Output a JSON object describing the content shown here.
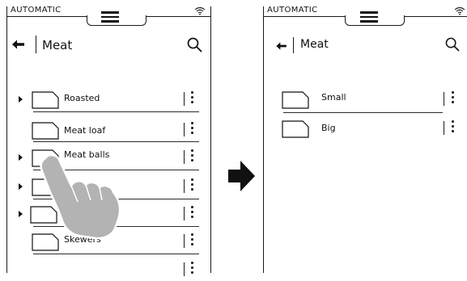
{
  "left_screen": {
    "status": {
      "mode": "AUTOMATIC",
      "menu_icon": "hamburger-menu-icon",
      "signal_icon": "wifi-icon"
    },
    "header": {
      "back_icon": "back-arrow-icon",
      "title": "Meat",
      "search_icon": "search-icon"
    },
    "items": [
      {
        "label": "Roasted",
        "expandable": true
      },
      {
        "label": "Meat loaf",
        "expandable": false
      },
      {
        "label": "Meat balls",
        "expandable": true
      },
      {
        "label": "",
        "expandable": true
      },
      {
        "label": "",
        "expandable": true
      },
      {
        "label": "Skewers",
        "expandable": false
      },
      {
        "label": "",
        "expandable": false
      }
    ],
    "gesture_icon": "tapping-hand-icon"
  },
  "transition_icon": "right-arrow-icon",
  "right_screen": {
    "status": {
      "mode": "AUTOMATIC",
      "menu_icon": "hamburger-menu-icon",
      "signal_icon": "wifi-icon"
    },
    "header": {
      "back_icon": "back-arrow-icon",
      "title": "Meat",
      "search_icon": "search-icon"
    },
    "items": [
      {
        "label": "Small"
      },
      {
        "label": "Big"
      }
    ]
  }
}
